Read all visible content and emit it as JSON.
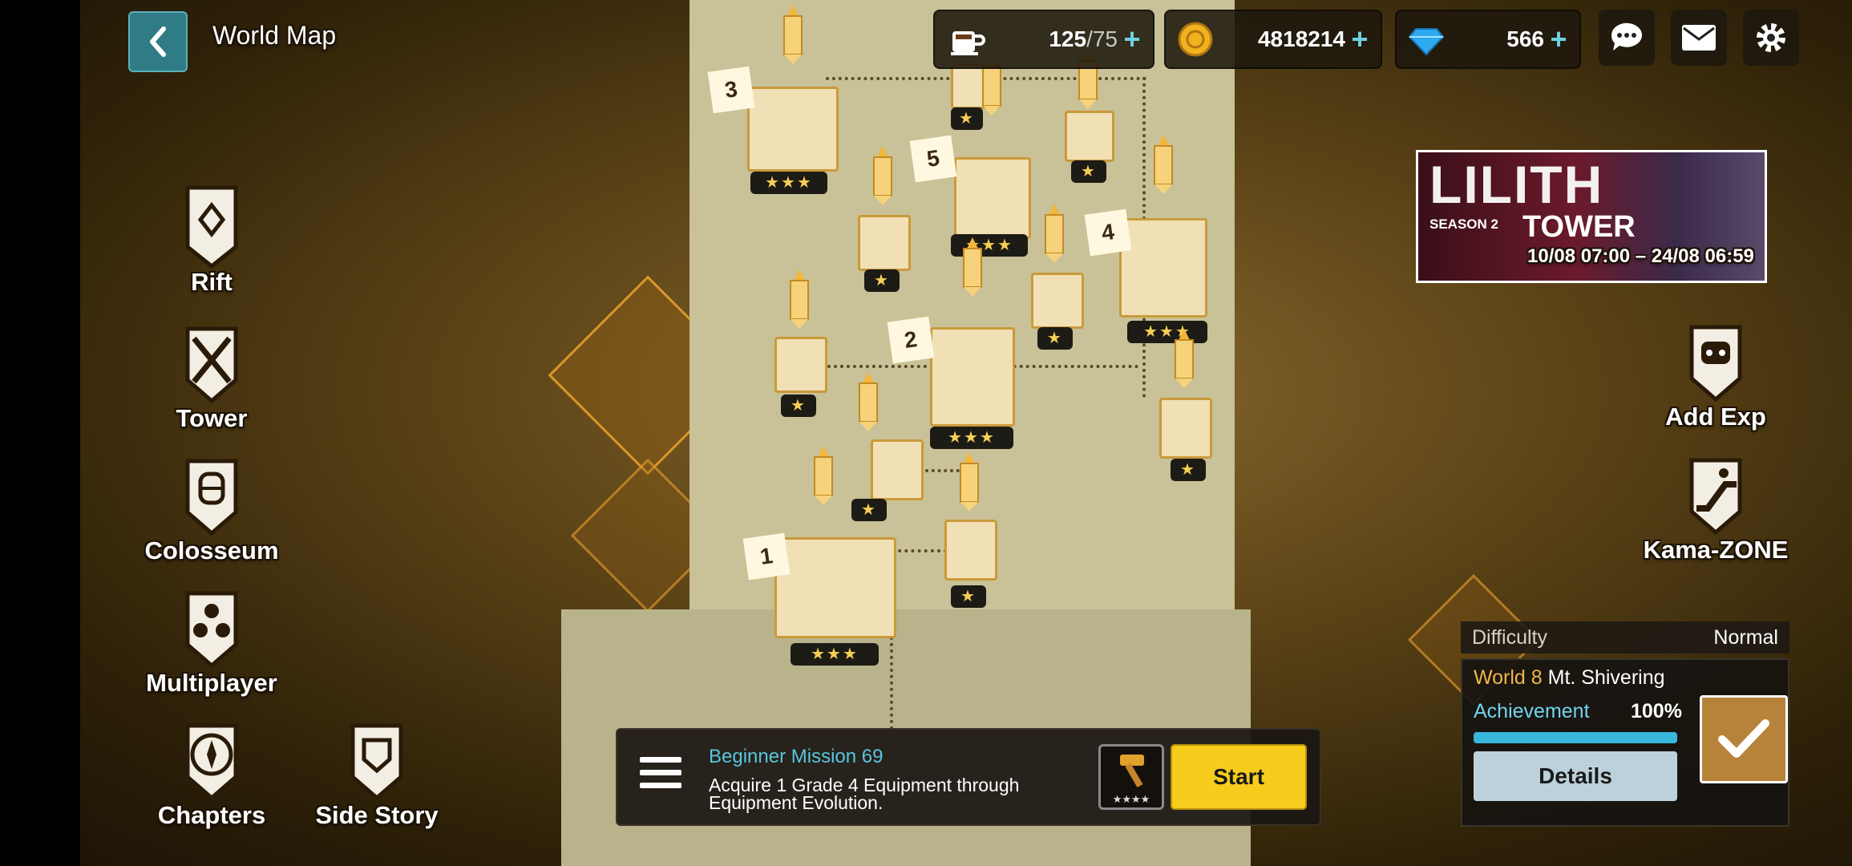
{
  "header": {
    "title": "World Map",
    "stamina": {
      "current": "125",
      "max": "/75"
    },
    "gold": "4818214",
    "gems": "566"
  },
  "left_menu": [
    {
      "label": "Rift",
      "icon": "rift-emblem-icon"
    },
    {
      "label": "Tower",
      "icon": "crossed-swords-icon"
    },
    {
      "label": "Colosseum",
      "icon": "knight-helmet-icon"
    },
    {
      "label": "Multiplayer",
      "icon": "party-icon"
    },
    {
      "label": "Chapters",
      "icon": "compass-icon"
    },
    {
      "label": "Side Story",
      "icon": "shield-icon"
    }
  ],
  "right_menu": [
    {
      "label": "Add Exp",
      "icon": "robot-icon"
    },
    {
      "label": "Kama-ZONE",
      "icon": "escalator-icon"
    }
  ],
  "banner": {
    "title": "LILITH",
    "season": "SEASON 2",
    "subtitle": "TOWER",
    "dates": "10/08 07:00 – 24/08 06:59"
  },
  "map": {
    "stage_numbers": [
      "1",
      "2",
      "3",
      "4",
      "5"
    ],
    "star_labels": {
      "three": "★★★",
      "one": "★"
    }
  },
  "mission": {
    "title": "Beginner Mission 69",
    "description": "Acquire 1 Grade 4 Equipment through Equipment Evolution.",
    "reward_stars": "★★★★",
    "start_label": "Start"
  },
  "info": {
    "difficulty_label": "Difficulty",
    "difficulty_value": "Normal",
    "world_num": "World 8",
    "world_name": "Mt. Shivering",
    "achievement_label": "Achievement",
    "achievement_value": "100%",
    "achievement_fraction": 1.0,
    "details_label": "Details"
  },
  "colors": {
    "accent_gold": "#f7cc1c",
    "accent_cyan": "#57c6e0",
    "panel_bg": "#1e1a14"
  }
}
